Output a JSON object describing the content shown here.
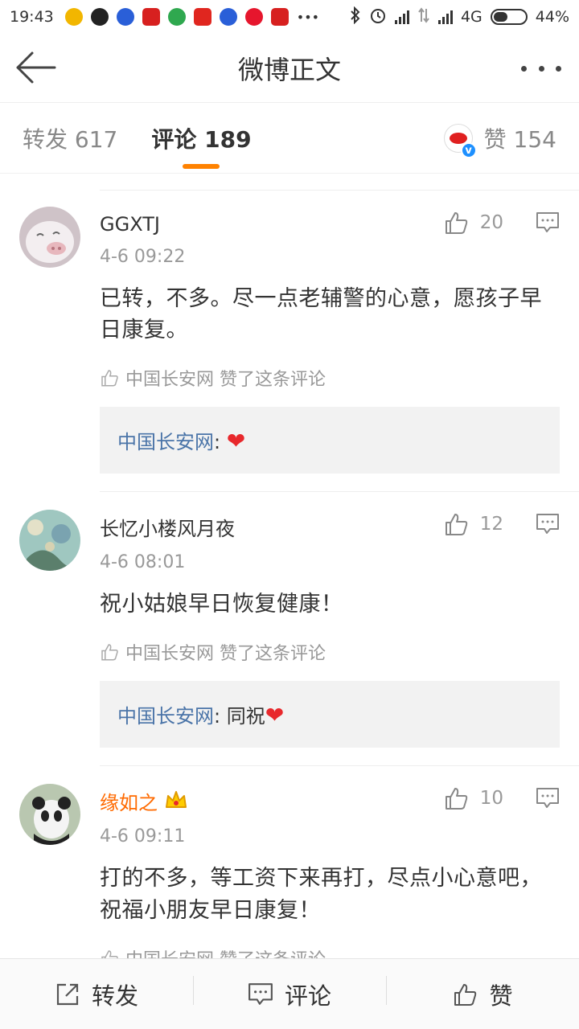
{
  "status": {
    "time": "19:43",
    "network": "4G",
    "battery": "44%",
    "battery_level": 0.44,
    "app_icons": [
      "gold-coin-icon",
      "qq-icon",
      "baidu-paw-icon",
      "netease-news-icon",
      "browser-icon",
      "toutiao-icon",
      "baidu-paw-icon",
      "weibo-icon",
      "netease-news-icon"
    ],
    "app_colors": [
      "#f2b600",
      "#222222",
      "#2a5fd8",
      "#d7201f",
      "#2fa84f",
      "#e0261f",
      "#2a5fd8",
      "#e6162d",
      "#d7201f"
    ],
    "more": "•••"
  },
  "header": {
    "title": "微博正文"
  },
  "tabs": {
    "repost": "转发 617",
    "comment": "评论 189",
    "likes": "赞 154"
  },
  "comments": [
    {
      "name": "GGXTJ",
      "time": "4-6 09:22",
      "text": "已转，不多。尽一点老辅警的心意，愿孩子早日康复。",
      "likes": "20",
      "liked_by": "中国长安网 赞了这条评论",
      "reply_author": "中国长安网",
      "reply_sep": ": ",
      "reply_text": "",
      "reply_emoji": "❤"
    },
    {
      "name": "长忆小楼风月夜",
      "time": "4-6 08:01",
      "text": "祝小姑娘早日恢复健康！",
      "likes": "12",
      "liked_by": "中国长安网 赞了这条评论",
      "reply_author": "中国长安网",
      "reply_sep": ": ",
      "reply_text": "同祝",
      "reply_emoji": "❤"
    },
    {
      "name": "缘如之",
      "time": "4-6 09:11",
      "text": "打的不多，等工资下来再打，尽点小心意吧，祝福小朋友早日康复！",
      "likes": "10",
      "liked_by": "中国长安网 赞了这条评论"
    }
  ],
  "bottom": {
    "repost": "转发",
    "comment": "评论",
    "like": "赞"
  },
  "colors": {
    "accent": "#ff8200",
    "reply_link": "#4a74a8",
    "heart": "#e8282c",
    "vip_name": "#ff6a00"
  }
}
